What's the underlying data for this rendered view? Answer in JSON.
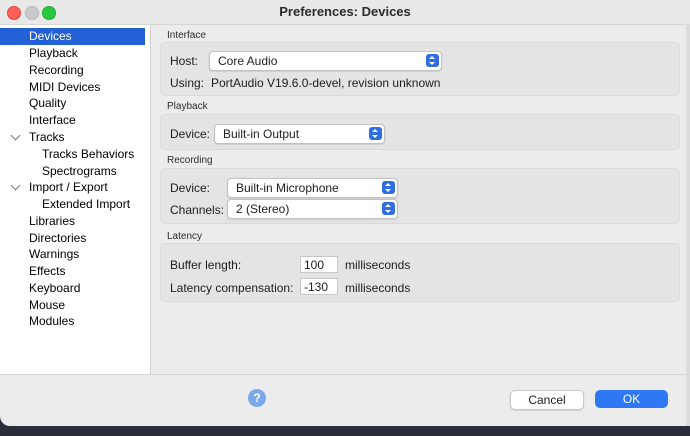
{
  "window": {
    "title": "Preferences: Devices"
  },
  "sidebar": {
    "items": [
      {
        "label": "Devices"
      },
      {
        "label": "Playback"
      },
      {
        "label": "Recording"
      },
      {
        "label": "MIDI Devices"
      },
      {
        "label": "Quality"
      },
      {
        "label": "Interface"
      },
      {
        "label": "Tracks"
      },
      {
        "label": "Tracks Behaviors"
      },
      {
        "label": "Spectrograms"
      },
      {
        "label": "Import / Export"
      },
      {
        "label": "Extended Import"
      },
      {
        "label": "Libraries"
      },
      {
        "label": "Directories"
      },
      {
        "label": "Warnings"
      },
      {
        "label": "Effects"
      },
      {
        "label": "Keyboard"
      },
      {
        "label": "Mouse"
      },
      {
        "label": "Modules"
      }
    ]
  },
  "interface": {
    "title": "Interface",
    "host_label": "Host:",
    "host_value": "Core Audio",
    "using_label": "Using:",
    "using_value": "PortAudio V19.6.0-devel, revision unknown"
  },
  "playback": {
    "title": "Playback",
    "device_label": "Device:",
    "device_value": "Built-in Output"
  },
  "recording": {
    "title": "Recording",
    "device_label": "Device:",
    "device_value": "Built-in Microphone",
    "channels_label": "Channels:",
    "channels_value": "2 (Stereo)"
  },
  "latency": {
    "title": "Latency",
    "buffer_label": "Buffer length:",
    "buffer_value": "100",
    "buffer_unit": "milliseconds",
    "comp_label": "Latency compensation:",
    "comp_value": "-130",
    "comp_unit": "milliseconds"
  },
  "footer": {
    "help_label": "?",
    "cancel_label": "Cancel",
    "ok_label": "OK"
  }
}
